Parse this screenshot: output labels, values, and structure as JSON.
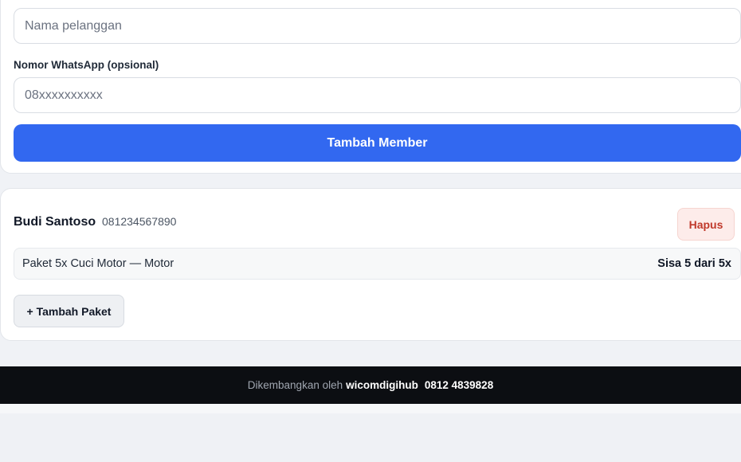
{
  "form": {
    "name_placeholder": "Nama pelanggan",
    "whatsapp_label": "Nomor WhatsApp (opsional)",
    "whatsapp_placeholder": "08xxxxxxxxxx",
    "submit_label": "Tambah Member"
  },
  "member": {
    "name": "Budi Santoso",
    "phone": "081234567890",
    "delete_label": "Hapus",
    "package": {
      "name": "Paket 5x Cuci Motor — Motor",
      "remaining": "Sisa 5 dari 5x"
    },
    "add_package_label": "+ Tambah Paket"
  },
  "footer": {
    "prefix": "Dikembangkan oleh",
    "brand": "wicomdigihub",
    "contact": "0812 4839828"
  },
  "colors": {
    "accent": "#3268f0",
    "danger": "#c0392b",
    "footer_bg": "#0c0e12"
  }
}
